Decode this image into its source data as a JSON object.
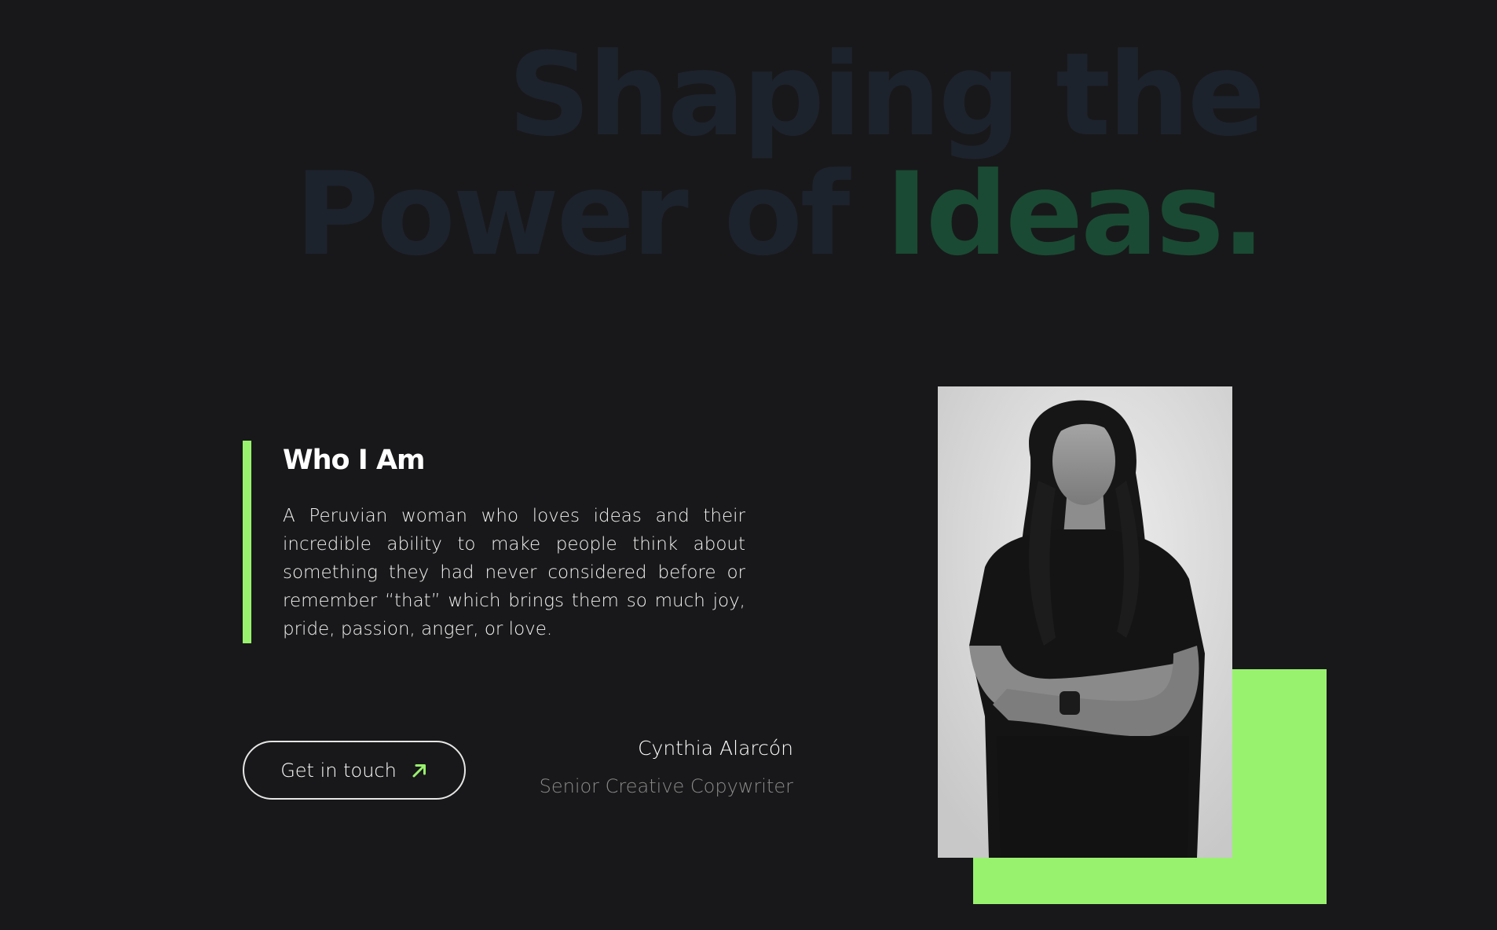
{
  "hero": {
    "line1": "Shaping the",
    "line2_prefix": "Power of ",
    "line2_accent": "Ideas."
  },
  "about": {
    "title": "Who I Am",
    "text": "A Peruvian woman who loves ideas and their incredible ability to make people think about something they had never considered before or remember “that” which brings them so much joy, pride, passion, anger, or love."
  },
  "cta": {
    "label": "Get in touch",
    "icon": "arrow-up-right-icon"
  },
  "person": {
    "name": "Cynthia Alarcón",
    "role": "Senior Creative Copywriter"
  },
  "colors": {
    "background": "#18181a",
    "accent_green": "#99f26e",
    "hero_text": "#1d232d",
    "hero_accent": "#1a4a33"
  }
}
